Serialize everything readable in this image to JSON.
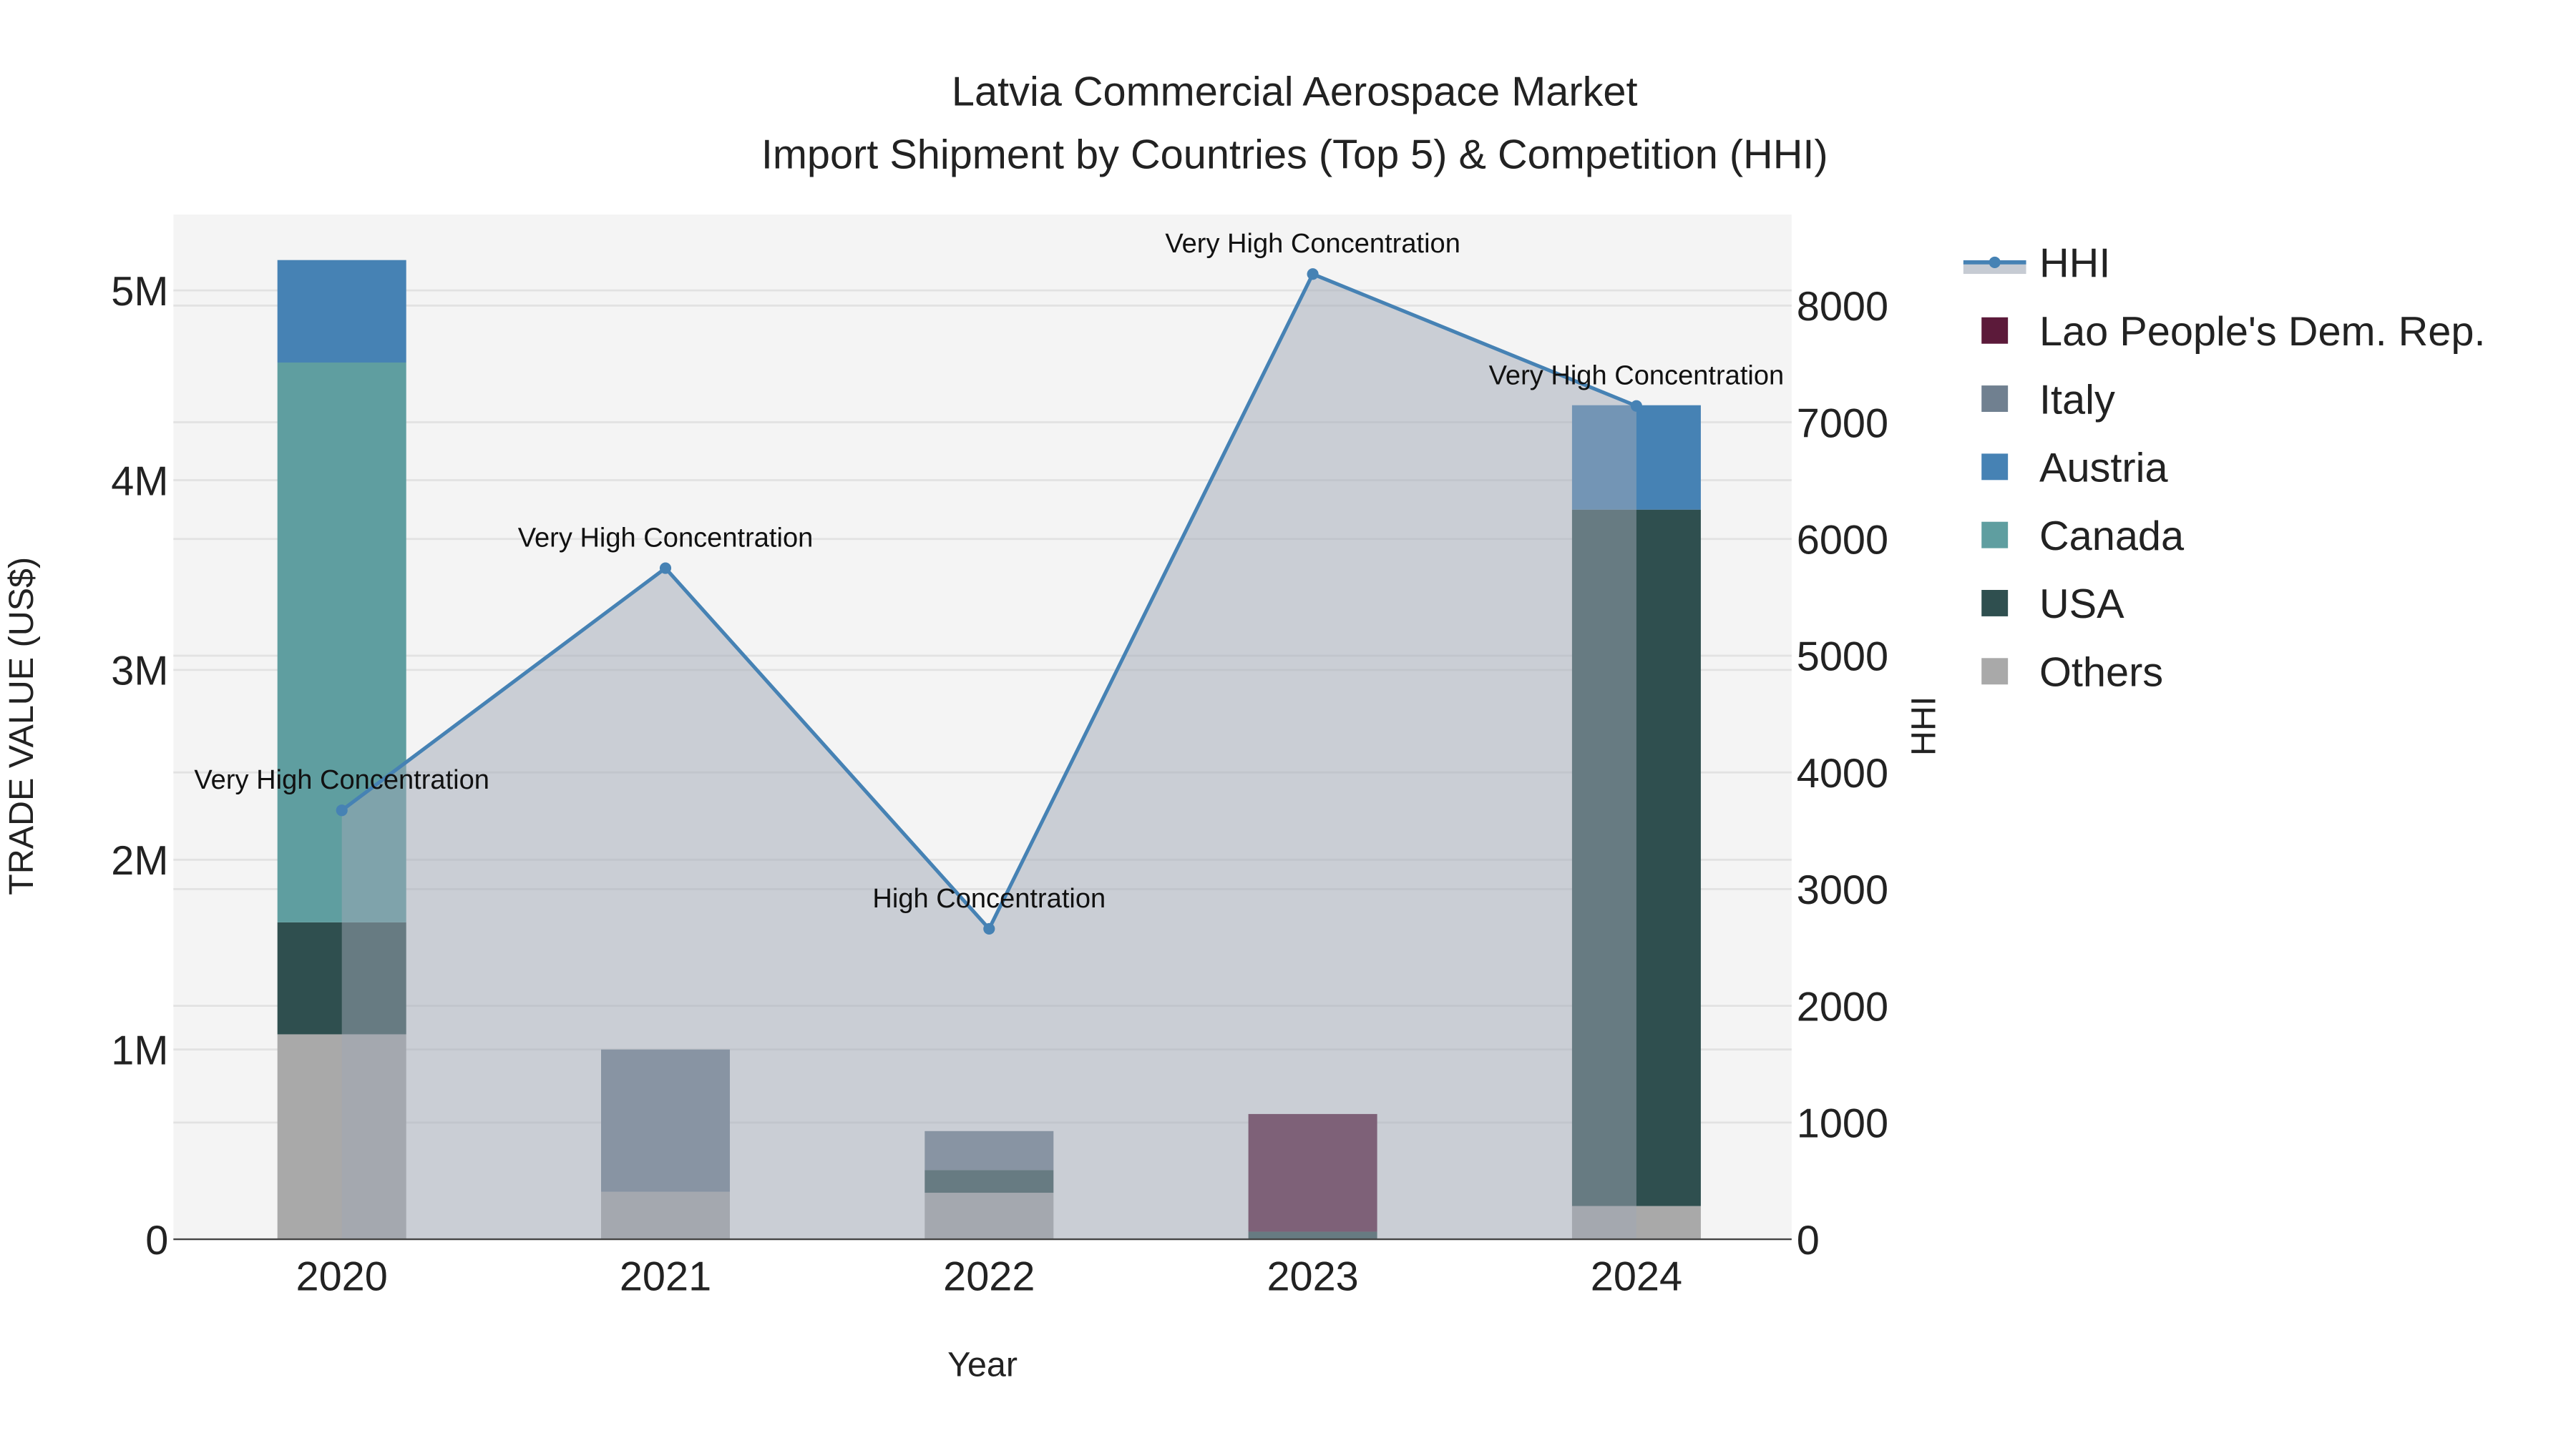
{
  "chart_data": {
    "type": "bar",
    "stacked": true,
    "title": "Latvia Commercial Aerospace Market",
    "subtitle": "Import Shipment by Countries (Top 5) & Competition (HHI)",
    "xlabel": "Year",
    "ylabel": "TRADE VALUE (US$)",
    "y2label": "HHI",
    "categories": [
      "2020",
      "2021",
      "2022",
      "2023",
      "2024"
    ],
    "ylim": [
      0,
      5400000
    ],
    "y_ticks": [
      0,
      1000000,
      2000000,
      3000000,
      4000000,
      5000000
    ],
    "y_tick_labels": [
      "0",
      "1M",
      "2M",
      "3M",
      "4M",
      "5M"
    ],
    "y2lim": [
      0,
      8780
    ],
    "y2_ticks": [
      0,
      1000,
      2000,
      3000,
      4000,
      5000,
      6000,
      7000,
      8000
    ],
    "y2_tick_labels": [
      "0",
      "1000",
      "2000",
      "3000",
      "4000",
      "5000",
      "6000",
      "7000",
      "8000"
    ],
    "series": [
      {
        "name": "Others",
        "color": "#a9a9a9",
        "values": [
          1080000,
          250000,
          245000,
          0,
          175000
        ]
      },
      {
        "name": "USA",
        "color": "#2f4f4f",
        "values": [
          590000,
          0,
          120000,
          40000,
          3670000
        ]
      },
      {
        "name": "Canada",
        "color": "#5f9ea0",
        "values": [
          2950000,
          0,
          0,
          0,
          0
        ]
      },
      {
        "name": "Austria",
        "color": "#4682b4",
        "values": [
          540000,
          0,
          0,
          0,
          550000
        ]
      },
      {
        "name": "Italy",
        "color": "#708090",
        "values": [
          0,
          750000,
          205000,
          0,
          0
        ]
      },
      {
        "name": "Lao People's Dem. Rep.",
        "color": "#5c1a3a",
        "values": [
          0,
          0,
          0,
          620000,
          0
        ]
      }
    ],
    "hhi": {
      "name": "HHI",
      "color": "#4682b4",
      "values": [
        3675,
        5750,
        2660,
        8270,
        7140
      ],
      "annotations": [
        "Very High Concentration",
        "Very High Concentration",
        "High Concentration",
        "Very High Concentration",
        "Very High Concentration"
      ]
    },
    "legend": {
      "placement": "right",
      "items": [
        "HHI",
        "Lao People's Dem. Rep.",
        "Italy",
        "Austria",
        "Canada",
        "USA",
        "Others"
      ]
    },
    "grid": true
  }
}
